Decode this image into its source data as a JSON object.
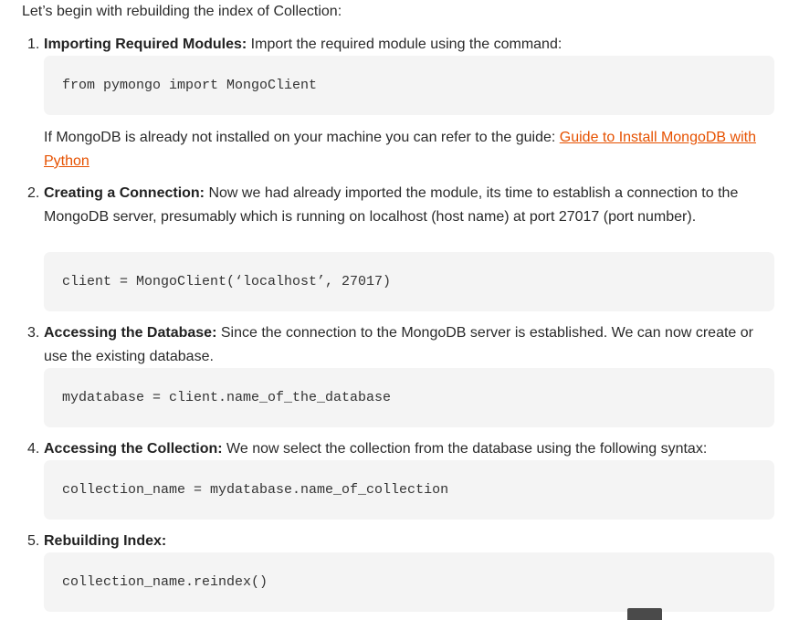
{
  "intro": "Let’s begin with rebuilding the index of Collection:",
  "steps": [
    {
      "num": "1.",
      "title": "Importing Required Modules:",
      "text": " Import the required module using the command:",
      "code": "from pymongo import MongoClient"
    },
    {
      "num": "2.",
      "title": "Creating a Connection:",
      "text": " Now we had already imported the module, its time to establish a connection to the MongoDB server, presumably which is running on localhost (host name) at port 27017 (port number).",
      "code": "client = MongoClient(‘localhost’, 27017)"
    },
    {
      "num": "3.",
      "title": "Accessing the Database:",
      "text": " Since the connection to the MongoDB server is established. We can now create or use the existing database.",
      "code": "mydatabase = client.name_of_the_database"
    },
    {
      "num": "4.",
      "title": "Accessing the Collection:",
      "text": " We now select the collection from the database using the following syntax:",
      "code": "collection_name = mydatabase.name_of_collection"
    },
    {
      "num": "5.",
      "title": "Rebuilding Index:",
      "text": "",
      "code": "collection_name.reindex()"
    }
  ],
  "note": {
    "text": "If MongoDB is already not installed on your machine you can refer to the guide: ",
    "link_text": "Guide to Install MongoDB with Python"
  },
  "colors": {
    "link": "#e65100",
    "code_bg": "#f4f4f4",
    "text": "#2a2a2a"
  }
}
